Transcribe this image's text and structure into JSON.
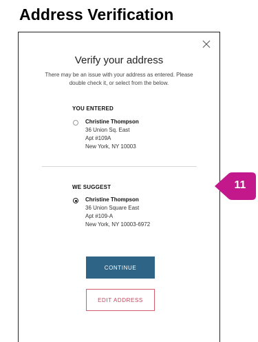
{
  "page_title": "Address Verification",
  "modal": {
    "heading": "Verify your address",
    "description_line1": "There may be an issue with your address as entered. Please",
    "description_line2": "double check it, or select from the below.",
    "entered": {
      "label": "YOU ENTERED",
      "name": "Christine Thompson",
      "line1": "36 Union Sq. East",
      "line2": "Apt #109A",
      "line3": "New York, NY 10003",
      "selected": false
    },
    "suggested": {
      "label": "WE SUGGEST",
      "name": "Christine Thompson",
      "line1": "36 Union Square East",
      "line2": "Apt #109-A",
      "line3": "New York, NY 10003-6972",
      "selected": true
    },
    "continue_label": "CONTINUE",
    "edit_label": "EDIT ADDRESS"
  },
  "callout": {
    "number": "11",
    "color": "#c2188b"
  },
  "colors": {
    "primary": "#2e6587",
    "accent": "#c2455a"
  }
}
